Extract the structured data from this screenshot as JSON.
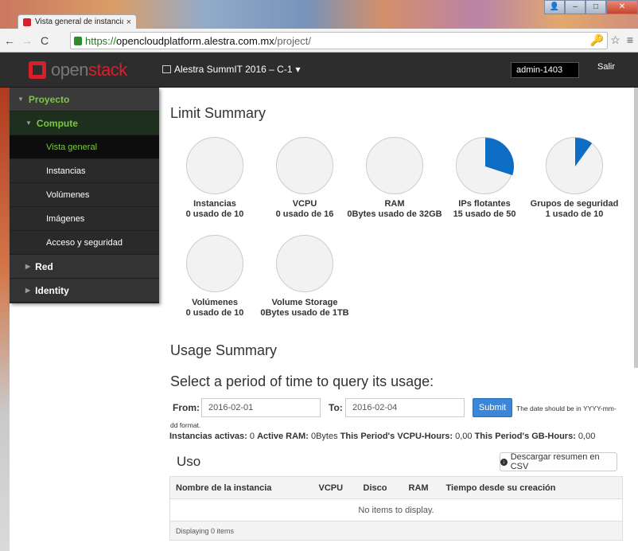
{
  "browser": {
    "tab_title": "Vista general de instancia",
    "tab_close": "×",
    "url_https": "https://",
    "url_host": "opencloudplatform.alestra.com.mx",
    "url_path": "/project/"
  },
  "header": {
    "logo_open": "open",
    "logo_stack": "stack",
    "project": "Alestra SummIT 2016 – C-1",
    "user": "admin-1403",
    "logout": "Salir"
  },
  "sidebar": {
    "proyecto": "Proyecto",
    "compute": "Compute",
    "items": [
      "Vista general",
      "Instancias",
      "Volúmenes",
      "Imágenes",
      "Acceso y seguridad"
    ],
    "groups": [
      "Red",
      "Identity"
    ]
  },
  "limit_summary": {
    "title": "Limit Summary",
    "items": [
      {
        "name": "Instancias",
        "usage": "0 usado de 10",
        "fraction": 0
      },
      {
        "name": "VCPU",
        "usage": "0 usado de 16",
        "fraction": 0
      },
      {
        "name": "RAM",
        "usage": "0Bytes usado de 32GB",
        "fraction": 0
      },
      {
        "name": "IPs flotantes",
        "usage": "15 usado de 50",
        "fraction": 0.3
      },
      {
        "name": "Grupos de seguridad",
        "usage": "1 usado de 10",
        "fraction": 0.1
      },
      {
        "name": "Volúmenes",
        "usage": "0 usado de 10",
        "fraction": 0
      },
      {
        "name": "Volume Storage",
        "usage": "0Bytes usado de 1TB",
        "fraction": 0
      }
    ],
    "accent": "#0d6dc4"
  },
  "usage_summary": {
    "title": "Usage Summary",
    "query_title": "Select a period of time to query its usage:",
    "from_label": "From:",
    "from_value": "2016-02-01",
    "to_label": "To:",
    "to_value": "2016-02-04",
    "submit": "Submit",
    "hint_a": "The date should be in YYYY-mm-",
    "hint_b": "dd format.",
    "stats": [
      {
        "label": "Instancias activas:",
        "value": "0"
      },
      {
        "label": "Active RAM:",
        "value": "0Bytes"
      },
      {
        "label": "This Period's VCPU-Hours:",
        "value": "0,00"
      },
      {
        "label": "This Period's GB-Hours:",
        "value": "0,00"
      }
    ]
  },
  "uso": {
    "title": "Uso",
    "csv_button": "Descargar resumen en CSV",
    "columns": [
      "Nombre de la instancia",
      "VCPU",
      "Disco",
      "RAM",
      "Tiempo desde su creación"
    ],
    "empty": "No items to display.",
    "footer": "Displaying 0 items"
  }
}
